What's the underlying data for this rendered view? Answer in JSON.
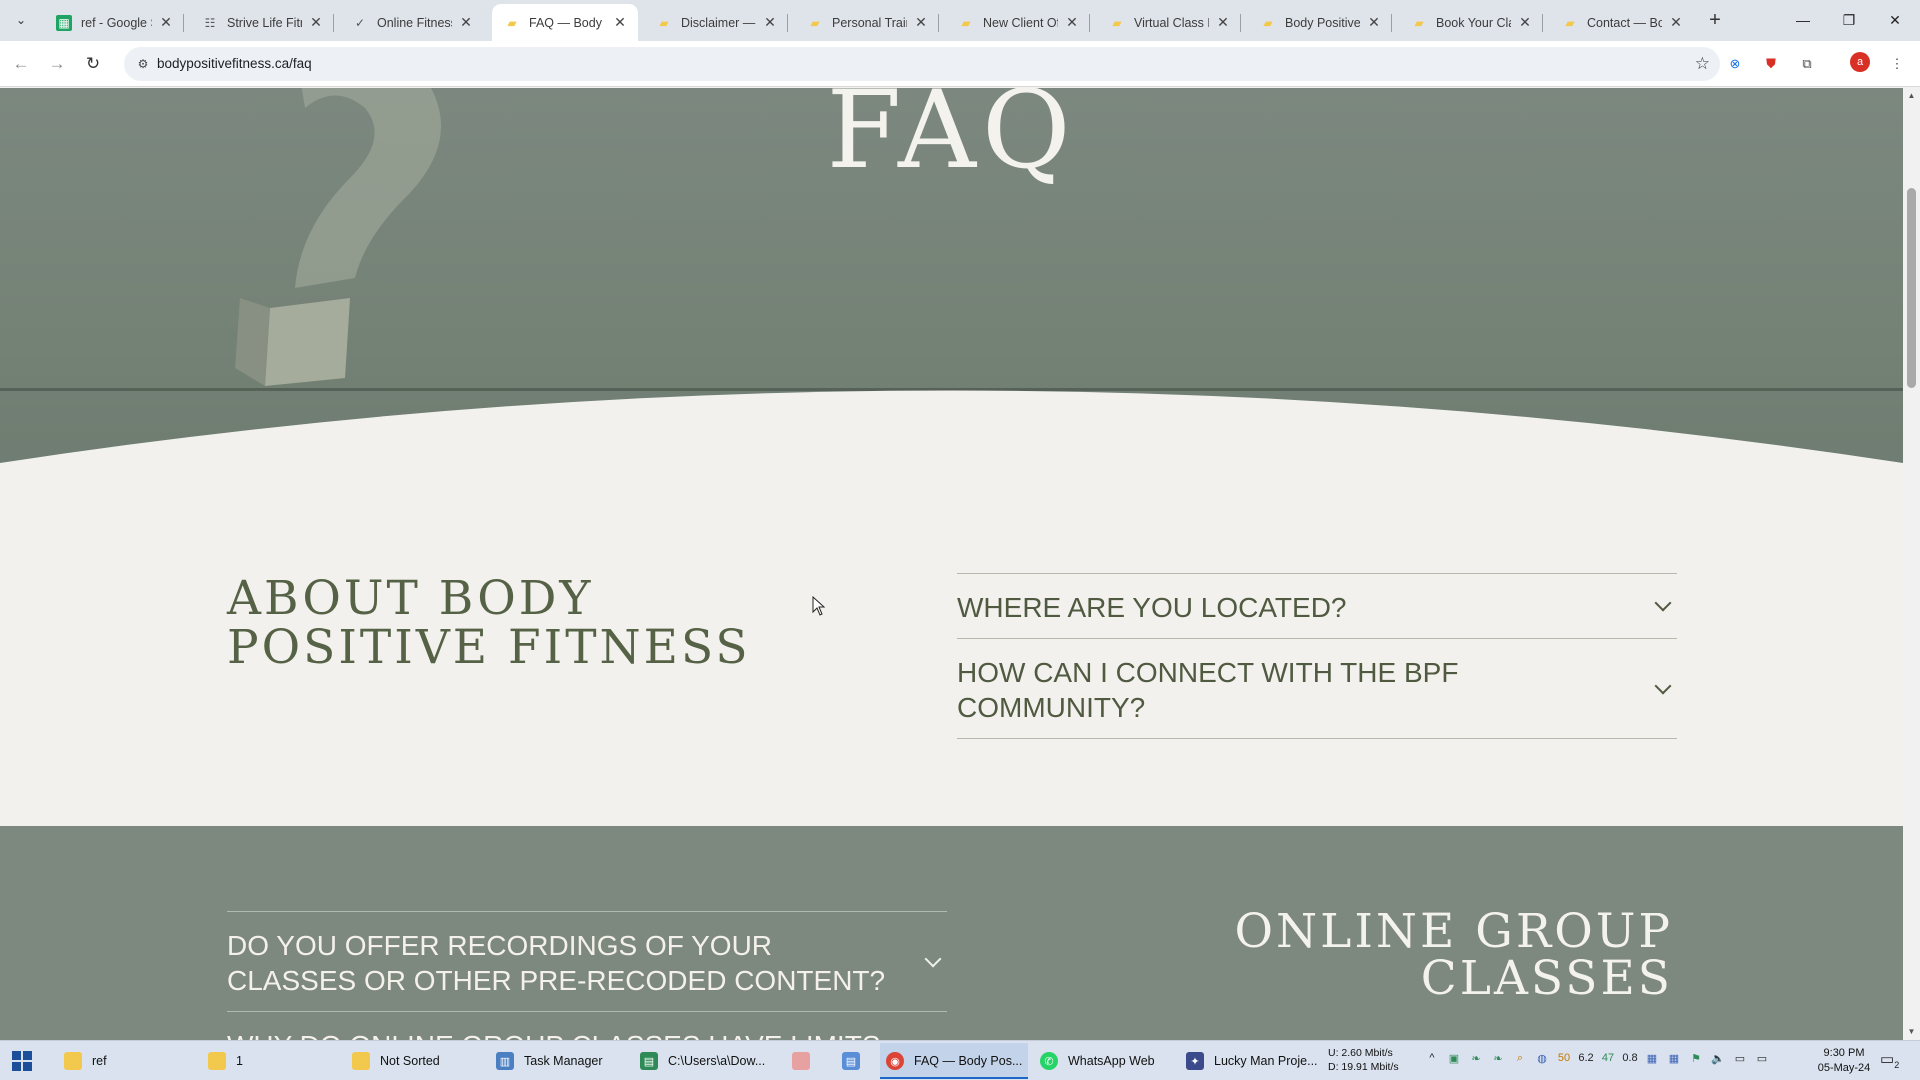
{
  "browser": {
    "tabs": [
      {
        "title": "ref - Google Sh",
        "favicon": "sheets-icon",
        "active": false
      },
      {
        "title": "Strive Life Fitne",
        "favicon": "strive-icon",
        "active": false
      },
      {
        "title": "Online Fitness",
        "favicon": "check-icon",
        "active": false
      },
      {
        "title": "FAQ — Body Pc",
        "favicon": "folder-icon",
        "active": true
      },
      {
        "title": "Disclaimer — B",
        "favicon": "folder-icon",
        "active": false
      },
      {
        "title": "Personal Trainin",
        "favicon": "folder-icon",
        "active": false
      },
      {
        "title": "New Client Off",
        "favicon": "folder-icon",
        "active": false
      },
      {
        "title": "Virtual Class Ra",
        "favicon": "folder-icon",
        "active": false
      },
      {
        "title": "Body Positive F",
        "favicon": "folder-icon",
        "active": false
      },
      {
        "title": "Book Your Clas",
        "favicon": "folder-icon",
        "active": false
      },
      {
        "title": "Contact — Boc",
        "favicon": "folder-icon",
        "active": false
      }
    ],
    "url": "bodypositivefitness.ca/faq",
    "profile_initial": "a"
  },
  "page": {
    "hero_title": "FAQ",
    "about_heading": "ABOUT BODY POSITIVE FITNESS",
    "about_faqs": [
      "WHERE ARE YOU LOCATED?",
      "HOW CAN I CONNECT WITH THE BPF COMMUNITY?"
    ],
    "online_heading": "ONLINE GROUP CLASSES",
    "online_faqs": [
      "DO YOU OFFER RECORDINGS OF YOUR CLASSES OR OTHER PRE-RECODED CONTENT?",
      "WHY DO ONLINE GROUP CLASSES HAVE LIMITS TO"
    ],
    "colors": {
      "hero_bg": "#778479",
      "heading_olive": "#566245",
      "page_bg": "#f3f1ee",
      "band_bg": "#7d887e"
    }
  },
  "taskbar": {
    "items": [
      {
        "label": "ref",
        "icon": "folder-icon"
      },
      {
        "label": "1",
        "icon": "folder-icon"
      },
      {
        "label": "Not Sorted",
        "icon": "folder-icon"
      },
      {
        "label": "Task Manager",
        "icon": "task-manager-icon"
      },
      {
        "label": "C:\\Users\\a\\Dow...",
        "icon": "notepad-icon"
      },
      {
        "label": "",
        "icon": "app-icon"
      },
      {
        "label": "",
        "icon": "document-icon"
      },
      {
        "label": "FAQ — Body Pos...",
        "icon": "chrome-icon"
      },
      {
        "label": "WhatsApp Web",
        "icon": "whatsapp-icon"
      },
      {
        "label": "Lucky Man Proje...",
        "icon": "app-icon"
      }
    ],
    "net_up": "U:   2.60 Mbit/s",
    "net_down": "D:   19.91 Mbit/s",
    "tray_values": [
      "50",
      "6.2",
      "47",
      "0.8"
    ],
    "time": "9:30 PM",
    "date": "05-May-24",
    "notification_count": "2"
  }
}
